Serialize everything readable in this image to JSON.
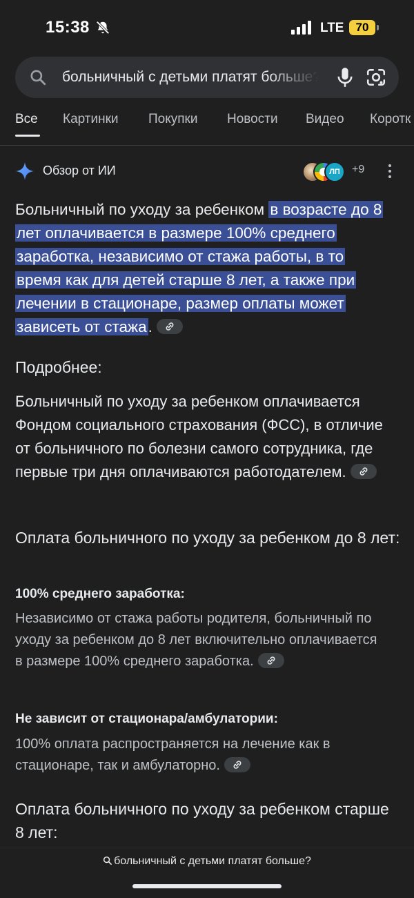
{
  "status": {
    "time": "15:38",
    "network": "LTE",
    "battery": "70"
  },
  "search": {
    "query": "больничный с детьми платят больше?"
  },
  "tabs": [
    {
      "label": "Все",
      "active": true
    },
    {
      "label": "Картинки"
    },
    {
      "label": "Покупки"
    },
    {
      "label": "Новости"
    },
    {
      "label": "Видео"
    },
    {
      "label": "Коротк"
    }
  ],
  "ai": {
    "title": "Обзор от ИИ",
    "sources_more": "+9",
    "source_badge": "ЛП"
  },
  "content": {
    "lead_plain": "Больничный по уходу за ребенком ",
    "lead_highlight": "в возрасте до 8 лет оплачивается в размере 100% среднего заработка, независимо от стажа работы, в то время как для детей старше 8 лет, а также при лечении в стационаре, размер оплаты может зависеть от стажа",
    "lead_end": ".",
    "more_heading": "Подробнее:",
    "more_text": "Больничный по уходу за ребенком оплачивается Фондом социального страхования (ФСС), в отличие от больничного по болезни самого сотрудника, где первые три дня оплачиваются работодателем.",
    "section1_heading": "Оплата больничного по уходу за ребенком до 8 лет:",
    "item1_title": "100% среднего заработка:",
    "item1_text": "Независимо от стажа работы родителя, больничный по уходу за ребенком до 8 лет включительно оплачивается в размере 100% среднего заработка.",
    "item2_title": "Не зависит от стационара/амбулатории:",
    "item2_text": "100% оплата распространяется на лечение как в стационаре, так и амбулаторно.",
    "section2_heading": "Оплата больничного по уходу за ребенком старше 8 лет:"
  },
  "bottom": {
    "query": "больничный с детьми платят больше?"
  },
  "colors": {
    "background": "#1f1f1f",
    "highlight": "#3a4f96",
    "search_bg": "#303134",
    "battery": "#f4d03f"
  }
}
